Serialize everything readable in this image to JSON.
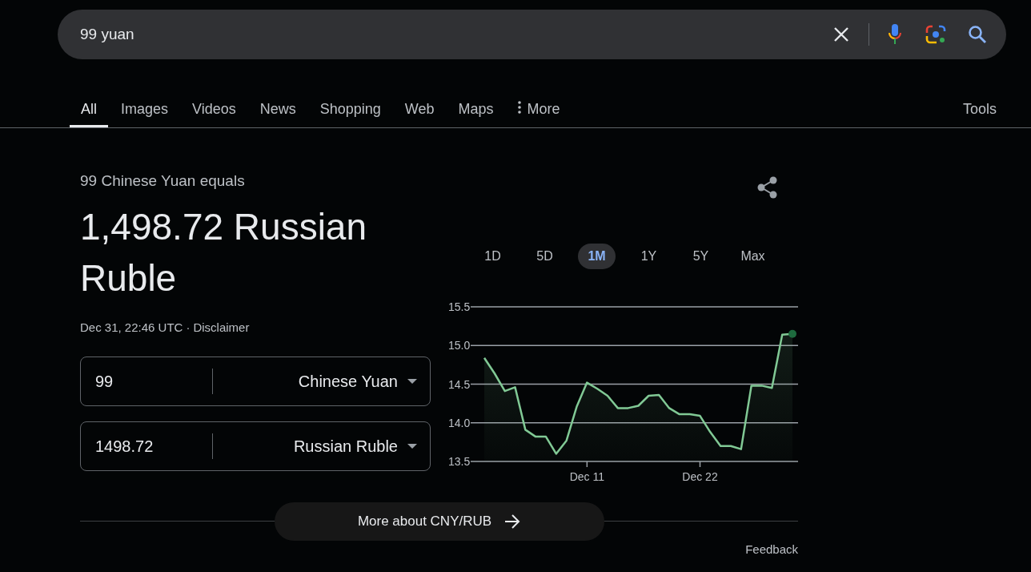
{
  "search": {
    "value": "99 yuan"
  },
  "tabs": [
    {
      "label": "All",
      "selected": true,
      "kind": "link"
    },
    {
      "label": "Images",
      "selected": false,
      "kind": "link"
    },
    {
      "label": "Videos",
      "selected": false,
      "kind": "link"
    },
    {
      "label": "News",
      "selected": false,
      "kind": "link"
    },
    {
      "label": "Shopping",
      "selected": false,
      "kind": "link"
    },
    {
      "label": "Web",
      "selected": false,
      "kind": "link"
    },
    {
      "label": "Maps",
      "selected": false,
      "kind": "link"
    },
    {
      "label": "More",
      "selected": false,
      "kind": "menu"
    }
  ],
  "tools": "Tools",
  "converter": {
    "heading": "99 Chinese Yuan equals",
    "result": "1,498.72 Russian Ruble",
    "timestamp": "Dec 31, 22:46 UTC",
    "separator": "·",
    "disclaimer": "Disclaimer",
    "rows": [
      {
        "amount": "99",
        "currency": "Chinese Yuan"
      },
      {
        "amount": "1498.72",
        "currency": "Russian Ruble"
      }
    ]
  },
  "ranges": [
    {
      "label": "1D",
      "selected": false
    },
    {
      "label": "5D",
      "selected": false
    },
    {
      "label": "1M",
      "selected": true
    },
    {
      "label": "1Y",
      "selected": false
    },
    {
      "label": "5Y",
      "selected": false
    },
    {
      "label": "Max",
      "selected": false
    }
  ],
  "chart_data": {
    "type": "area",
    "categories": [
      null,
      null,
      null,
      null,
      null,
      null,
      null,
      null,
      null,
      null,
      "Dec 11",
      null,
      null,
      null,
      null,
      null,
      null,
      null,
      null,
      null,
      null,
      "Dec 22",
      null,
      null,
      null,
      null,
      null,
      null,
      null,
      null,
      null
    ],
    "series": [
      {
        "color": "#81c995",
        "values": [
          14.84,
          14.64,
          14.41,
          14.46,
          13.91,
          13.82,
          13.82,
          13.6,
          13.77,
          14.21,
          14.52,
          14.44,
          14.35,
          14.19,
          14.19,
          14.22,
          14.35,
          14.36,
          14.19,
          14.11,
          14.11,
          14.09,
          13.88,
          13.7,
          13.7,
          13.66,
          14.48,
          14.48,
          14.45,
          15.14,
          15.15
        ]
      }
    ],
    "ylim": [
      13.5,
      15.5
    ],
    "grid": true,
    "yticks": [
      {
        "value": 15.5,
        "label": "15.5"
      },
      {
        "value": 15,
        "label": "15.0"
      },
      {
        "value": 14.5,
        "label": "14.5"
      },
      {
        "value": 14,
        "label": "14.0"
      },
      {
        "value": 13.5,
        "label": "13.5"
      }
    ]
  },
  "more_button": "More about CNY/RUB",
  "feedback": "Feedback"
}
